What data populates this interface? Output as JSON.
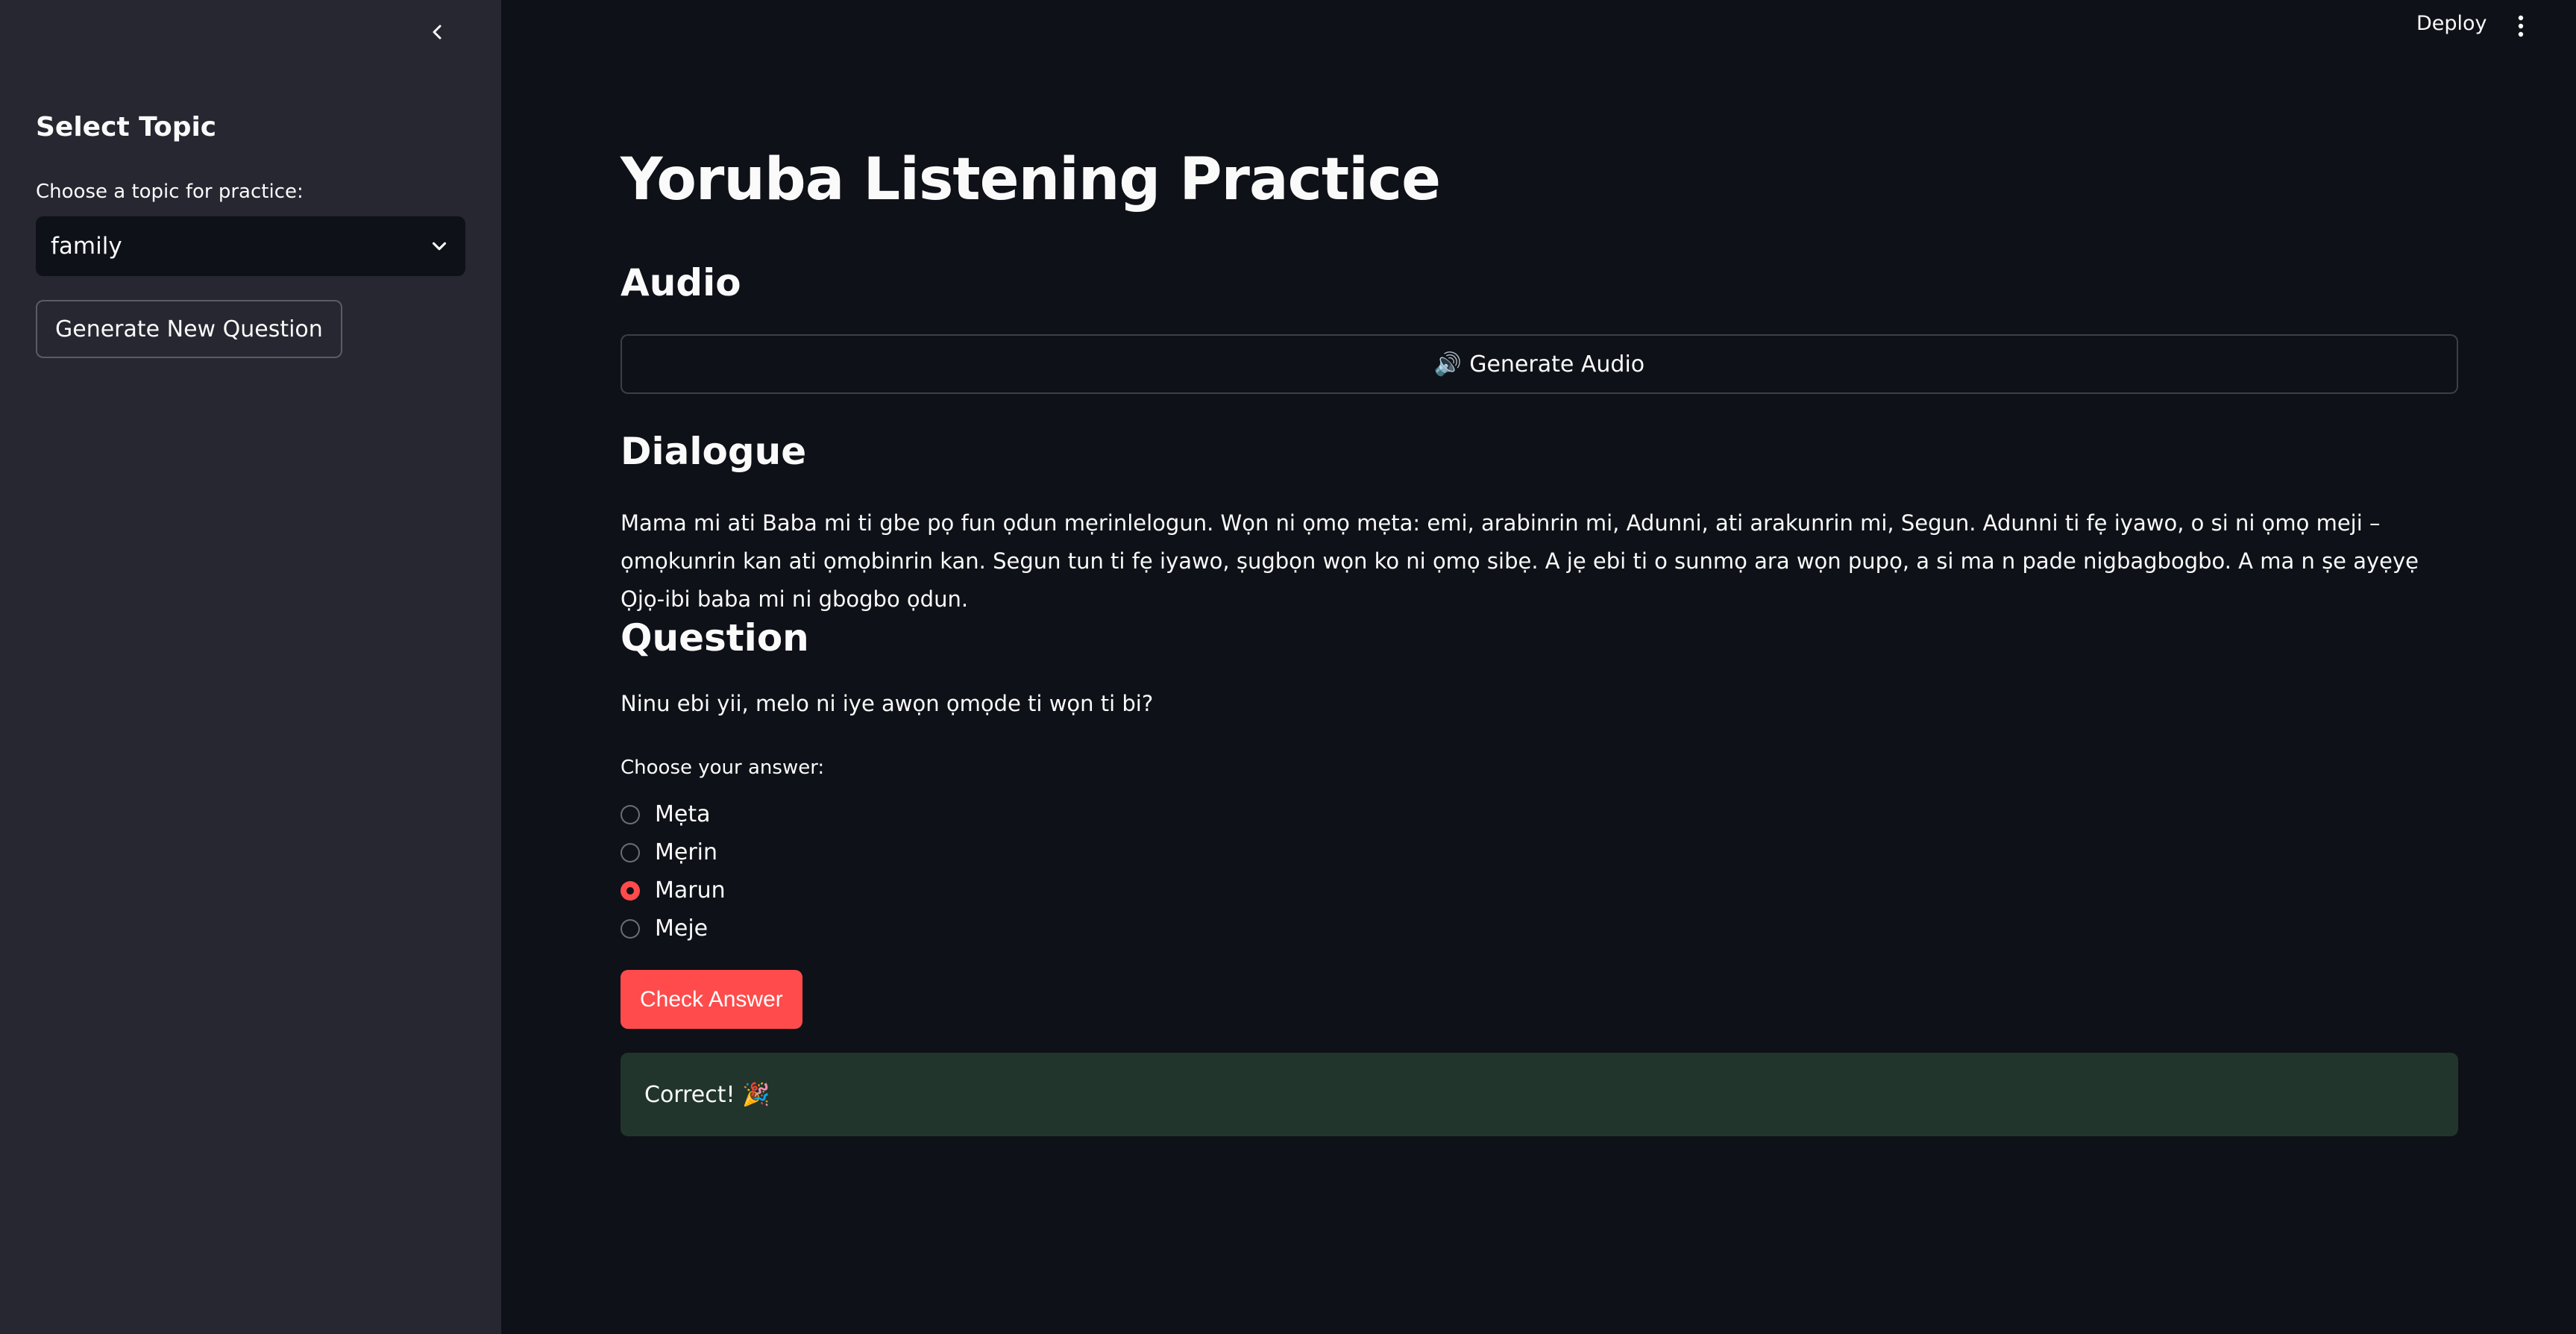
{
  "sidebar": {
    "heading": "Select Topic",
    "select_label": "Choose a topic for practice:",
    "selected_topic": "family",
    "generate_button": "Generate New Question"
  },
  "header": {
    "deploy_label": "Deploy"
  },
  "main": {
    "title": "Yoruba Listening Practice",
    "audio_heading": "Audio",
    "audio_button": {
      "icon": "🔊",
      "label": "Generate Audio"
    },
    "dialogue_heading": "Dialogue",
    "dialogue_text": "Mama mi ati Baba mi ti gbe pọ fun ọdun mẹrinlelogun. Wọn ni ọmọ mẹta: emi, arabinrin mi, Adunni, ati arakunrin mi, Segun. Adunni ti fẹ iyawo, o si ni ọmọ meji – ọmọkunrin kan ati ọmọbinrin kan. Segun tun ti fẹ iyawo, ṣugbọn wọn ko ni ọmọ sibẹ. A jẹ ebi ti o sunmọ ara wọn pupọ, a si ma n pade nigbagbogbo. A ma n ṣe ayẹyẹ Ọjọ-ibi baba mi ni gbogbo ọdun.",
    "question_heading": "Question",
    "question_text": "Ninu ebi yii, melo ni iye awọn ọmọde ti wọn ti bi?",
    "answer_label": "Choose your answer:",
    "options": [
      "Mẹta",
      "Mẹrin",
      "Marun",
      "Meje"
    ],
    "selected_option": "Marun",
    "check_button": "Check Answer",
    "result_text": "Correct! 🎉"
  },
  "colors": {
    "background": "#0e1117",
    "sidebar": "#262730",
    "primary": "#ff4b4b",
    "success_bg": "#21352c"
  }
}
